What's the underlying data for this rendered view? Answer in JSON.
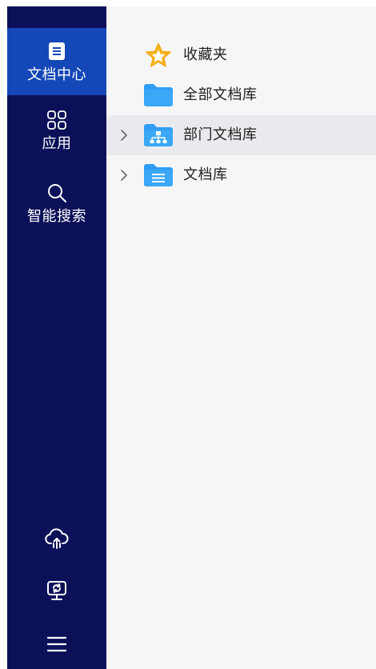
{
  "sidebar": {
    "items": [
      {
        "label": "文档中心",
        "icon": "document-icon",
        "active": true
      },
      {
        "label": "应用",
        "icon": "apps-grid-icon",
        "active": false
      },
      {
        "label": "智能搜索",
        "icon": "search-icon",
        "active": false
      }
    ],
    "bottom_icons": [
      "cloud-upload-icon",
      "monitor-sync-icon",
      "menu-icon"
    ]
  },
  "tree": {
    "items": [
      {
        "label": "收藏夹",
        "icon": "star-icon",
        "expandable": false
      },
      {
        "label": "全部文档库",
        "icon": "folder-icon",
        "expandable": false
      },
      {
        "label": "部门文档库",
        "icon": "org-folder-icon",
        "expandable": true,
        "highlighted": true
      },
      {
        "label": "文档库",
        "icon": "doc-folder-icon",
        "expandable": true
      }
    ]
  },
  "colors": {
    "sidebar_bg": "#0b1058",
    "active_bg": "#1447b7",
    "content_bg": "#f6f6f6",
    "hover_row": "#e9eaee",
    "folder_blue": "#2f9df5",
    "star": "#f5b21b"
  }
}
